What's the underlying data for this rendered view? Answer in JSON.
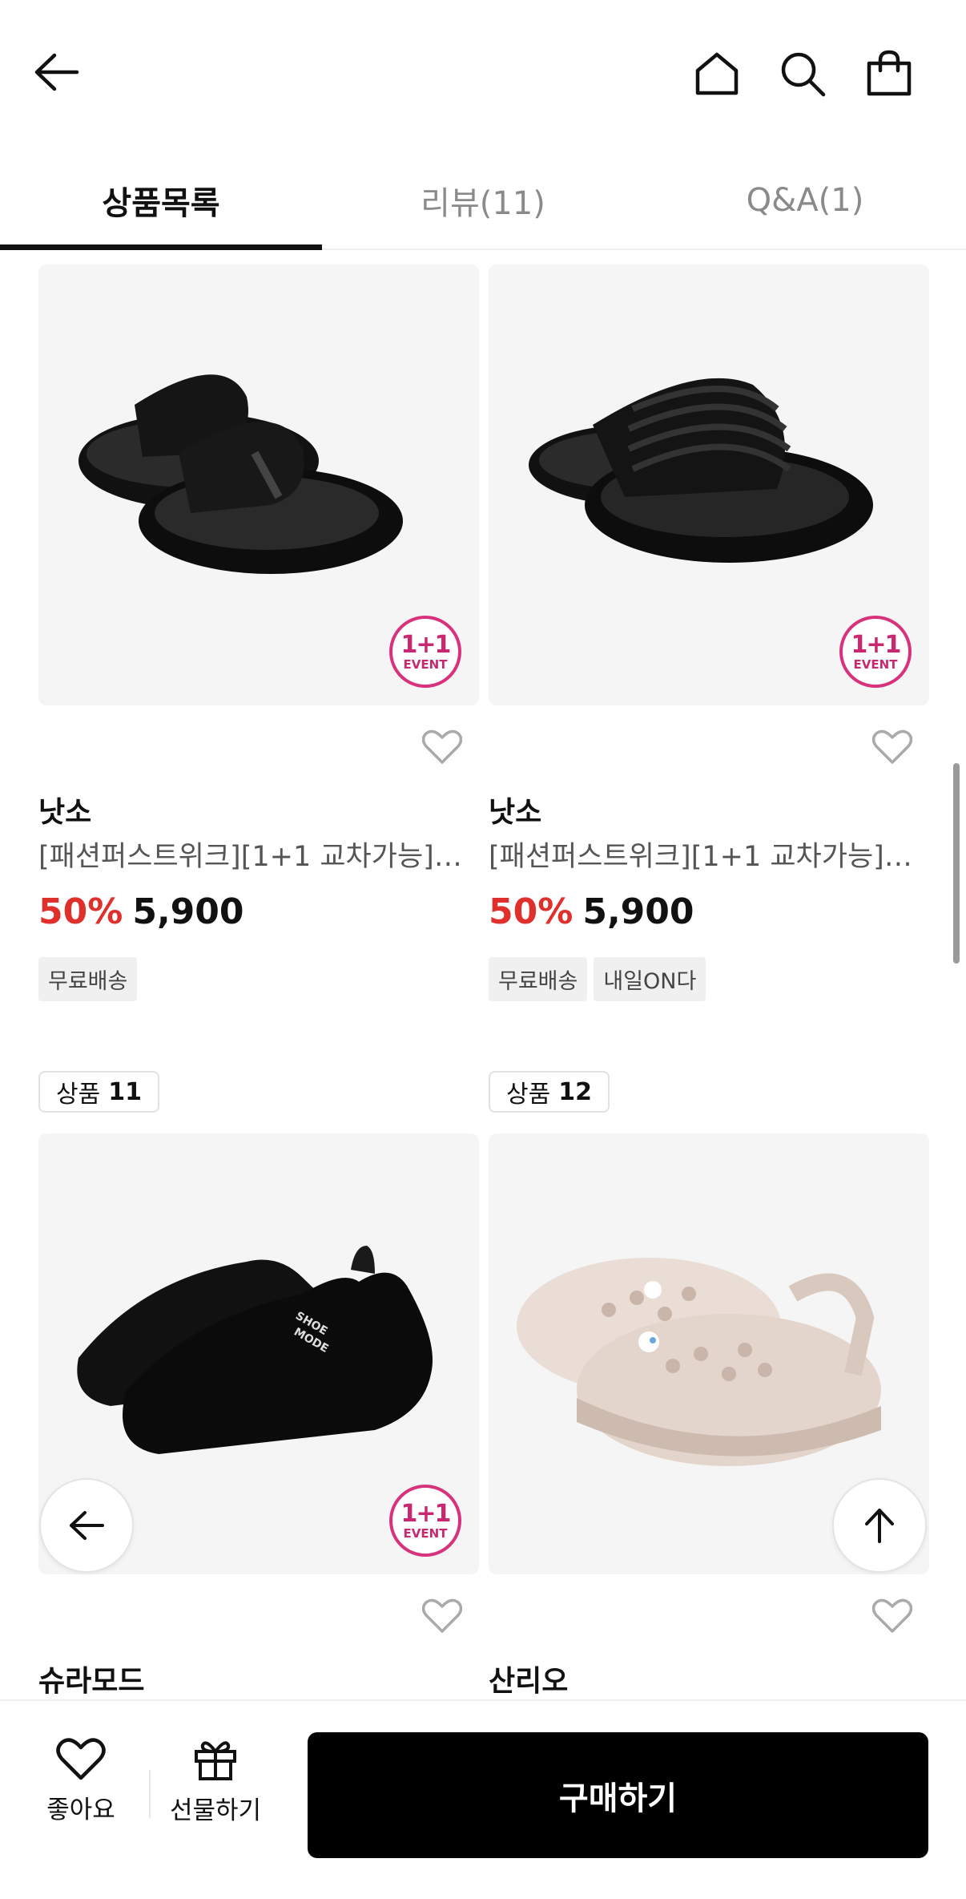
{
  "tabs": [
    {
      "label": "상품목록",
      "active": true
    },
    {
      "label": "리뷰(11)",
      "active": false
    },
    {
      "label": "Q&A(1)",
      "active": false
    }
  ],
  "products": [
    {
      "brand": "낫소",
      "name": "[패션퍼스트위크][1+1 교차가능]낫소",
      "discount": "50%",
      "price": "5,900",
      "tags": [
        "무료배송"
      ],
      "event_badge": {
        "line1": "1+1",
        "line2": "EVENT"
      }
    },
    {
      "brand": "낫소",
      "name": "[패션퍼스트위크][1+1 교차가능]낫소",
      "discount": "50%",
      "price": "5,900",
      "tags": [
        "무료배송",
        "내일ON다"
      ],
      "event_badge": {
        "line1": "1+1",
        "line2": "EVENT"
      }
    },
    {
      "rank_prefix": "상품",
      "rank": "11",
      "brand": "슈라모드",
      "event_badge": {
        "line1": "1+1",
        "line2": "EVENT"
      },
      "shoe_print": {
        "line1": "SHOE",
        "line2": "MODE"
      }
    },
    {
      "rank_prefix": "상품",
      "rank": "12",
      "brand": "산리오"
    }
  ],
  "bottom_bar": {
    "like_label": "좋아요",
    "gift_label": "선물하기",
    "buy_label": "구매하기"
  },
  "colors": {
    "discount": "#e0302c",
    "event_badge": "#d8327d",
    "buy_button": "#000000"
  }
}
